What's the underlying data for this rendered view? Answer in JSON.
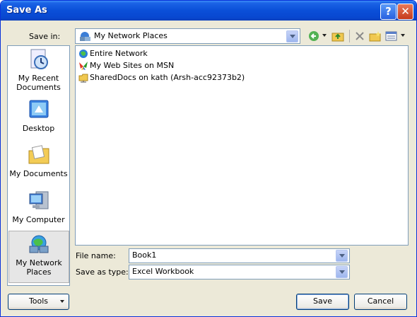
{
  "window": {
    "title": "Save As"
  },
  "toolbar": {
    "save_in_label": "Save in:",
    "location": "My Network Places"
  },
  "places": [
    {
      "line1": "My Recent",
      "line2": "Documents"
    },
    {
      "line1": "Desktop",
      "line2": ""
    },
    {
      "line1": "My Documents",
      "line2": ""
    },
    {
      "line1": "My Computer",
      "line2": ""
    },
    {
      "line1": "My Network",
      "line2": "Places"
    }
  ],
  "files": [
    {
      "name": "Entire Network",
      "icon": "globe-icon"
    },
    {
      "name": "My Web Sites on MSN",
      "icon": "msn-butterfly-icon"
    },
    {
      "name": "SharedDocs on kath (Arsh-acc92373b2)",
      "icon": "network-folder-icon"
    }
  ],
  "form": {
    "file_name_label": "File name:",
    "file_name_value": "Book1",
    "save_type_label": "Save as type:",
    "save_type_value": "Excel Workbook"
  },
  "buttons": {
    "tools": "Tools",
    "save": "Save",
    "cancel": "Cancel"
  }
}
